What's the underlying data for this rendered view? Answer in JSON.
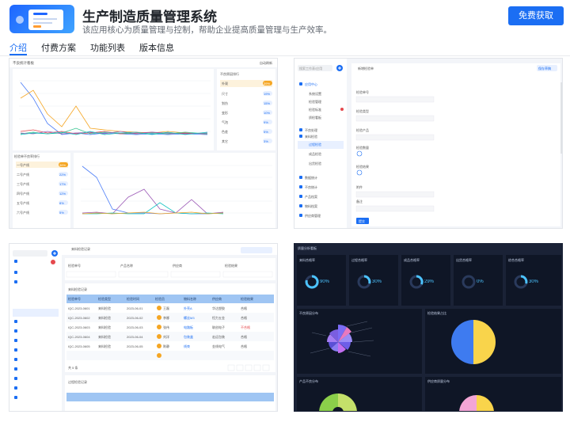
{
  "header": {
    "app_name": "生产制造质量管理系统",
    "description": "该应用核心为质量管理与控制，帮助企业提高质量管理与生产效率。",
    "cta_label": "免费获取"
  },
  "tabs": [
    {
      "label": "介绍",
      "active": true
    },
    {
      "label": "付费方案",
      "active": false
    },
    {
      "label": "功能列表",
      "active": false
    },
    {
      "label": "版本信息",
      "active": false
    }
  ],
  "colors": {
    "primary": "#1b6ef3",
    "dark_bg": "#1a2236",
    "accent_orange": "#f5a623"
  },
  "shot1": {
    "title": "不良统计看板",
    "refresh": "自动刷新",
    "panel_left_title": "不良原因排行",
    "reasons": [
      {
        "name": "外观",
        "pct": "39%"
      },
      {
        "name": "尺寸",
        "pct": "19%"
      },
      {
        "name": "划伤",
        "pct": "15%"
      },
      {
        "name": "变形",
        "pct": "10%"
      },
      {
        "name": "气泡",
        "pct": "9%"
      },
      {
        "name": "色差",
        "pct": "5%"
      },
      {
        "name": "其它",
        "pct": "3%"
      }
    ],
    "bottom_left_title": "检验单不良率排行",
    "lines": [
      {
        "name": "一号产线",
        "pct": "36%"
      },
      {
        "name": "二号产线",
        "pct": "22%"
      },
      {
        "name": "三号产线",
        "pct": "17%"
      },
      {
        "name": "四号产线",
        "pct": "12%"
      },
      {
        "name": "五号产线",
        "pct": "8%"
      },
      {
        "name": "六号产线",
        "pct": "5%"
      }
    ]
  },
  "shot2": {
    "search_placeholder": "搜索工作表/应用",
    "nav": [
      "应用中心",
      "系统设置",
      "检验管理",
      "检验标准",
      "质检看板",
      "不良处理",
      "来料检验",
      "过程检验",
      "成品检验",
      "出货检验",
      "数据统计",
      "不良统计",
      "产品档案",
      "物料档案",
      "供应商管理"
    ],
    "form_title": "新增检验单",
    "form_labels": [
      "检验单号",
      "检验类型",
      "检验产品",
      "检验数量",
      "检验结果",
      "附件",
      "备注"
    ],
    "submit_label": "提交",
    "save_label": "保存草稿"
  },
  "shot3": {
    "toolbar_title": "来料检验记录",
    "filters": [
      "检验单号",
      "产品名称",
      "供应商",
      "检验结果"
    ],
    "columns": [
      "检验单号",
      "检验类型",
      "检验时间",
      "检验员",
      "物料名称",
      "供应商",
      "检验结果"
    ],
    "rows": [
      [
        "IQC-2023-0601",
        "来料检验",
        "2023-06-01",
        "王磊",
        "外壳A",
        "华达塑胶",
        "合格"
      ],
      [
        "IQC-2023-0602",
        "来料检验",
        "2023-06-02",
        "李娜",
        "螺丝M3",
        "恒力五金",
        "合格"
      ],
      [
        "IQC-2023-0603",
        "来料检验",
        "2023-06-03",
        "张伟",
        "电路板",
        "联创电子",
        "不合格"
      ],
      [
        "IQC-2023-0604",
        "来料检验",
        "2023-06-04",
        "刘洋",
        "包装盒",
        "宏远包装",
        "合格"
      ],
      [
        "IQC-2023-0605",
        "来料检验",
        "2023-06-05",
        "陈静",
        "线束",
        "金线电气",
        "合格"
      ]
    ],
    "pagination": "共 5 条",
    "second_table_title": "过程检验记录"
  },
  "shot4": {
    "title": "质量分析看板",
    "kpis": [
      {
        "label": "来料合格率",
        "value": "90%"
      },
      {
        "label": "过程合格率",
        "value": "30%"
      },
      {
        "label": "成品合格率",
        "value": "29%"
      },
      {
        "label": "出货合格率",
        "value": "0%"
      },
      {
        "label": "综合合格率",
        "value": "30%"
      }
    ],
    "panel_titles": [
      "不良原因分布",
      "检验结果占比",
      "产品不良分布",
      "供应商质量分布"
    ]
  }
}
